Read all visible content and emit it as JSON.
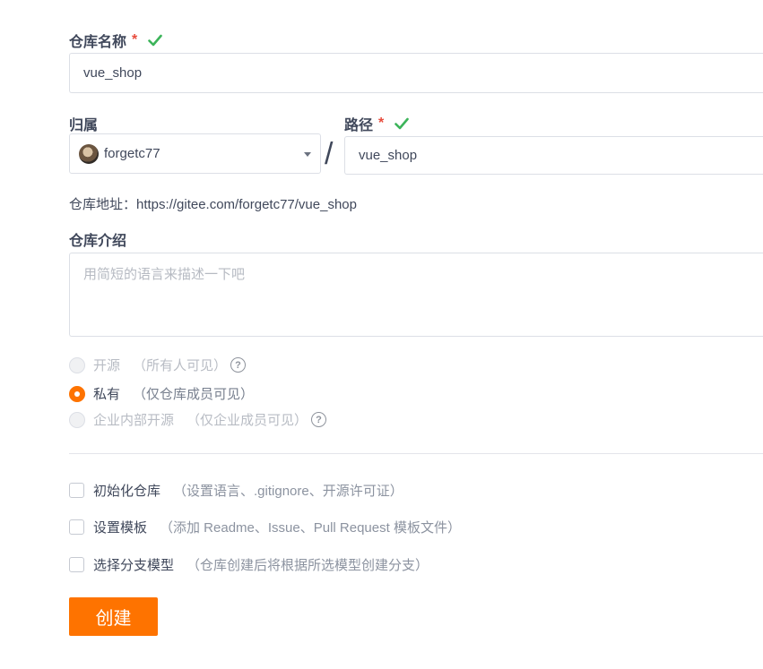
{
  "repo_name": {
    "label": "仓库名称",
    "required_mark": "*",
    "value": "vue_shop"
  },
  "owner": {
    "label": "归属",
    "value": "forgetc77"
  },
  "path": {
    "label": "路径",
    "required_mark": "*",
    "value": "vue_shop",
    "separator": "/"
  },
  "repo_address": "仓库地址：https://gitee.com/forgetc77/vue_shop",
  "intro": {
    "label": "仓库介绍",
    "placeholder": "用简短的语言来描述一下吧"
  },
  "visibility": [
    {
      "label": "开源",
      "hint": "（所有人可见）",
      "checked": false,
      "disabled": true,
      "help": "?"
    },
    {
      "label": "私有",
      "hint": "（仅仓库成员可见）",
      "checked": true,
      "disabled": false
    },
    {
      "label": "企业内部开源",
      "hint": "（仅企业成员可见）",
      "checked": false,
      "disabled": true,
      "help": "?"
    }
  ],
  "options": [
    {
      "label": "初始化仓库",
      "hint": "（设置语言、.gitignore、开源许可证）"
    },
    {
      "label": "设置模板",
      "hint": "（添加 Readme、Issue、Pull Request 模板文件）"
    },
    {
      "label": "选择分支模型",
      "hint": "（仓库创建后将根据所选模型创建分支）"
    }
  ],
  "submit_label": "创建",
  "colors": {
    "accent": "#fe7300",
    "required": "#e84c3d",
    "valid": "#3cb45a"
  },
  "icons": {
    "valid": "check-icon",
    "select": "caret-down-icon",
    "help": "question-circle-icon"
  }
}
